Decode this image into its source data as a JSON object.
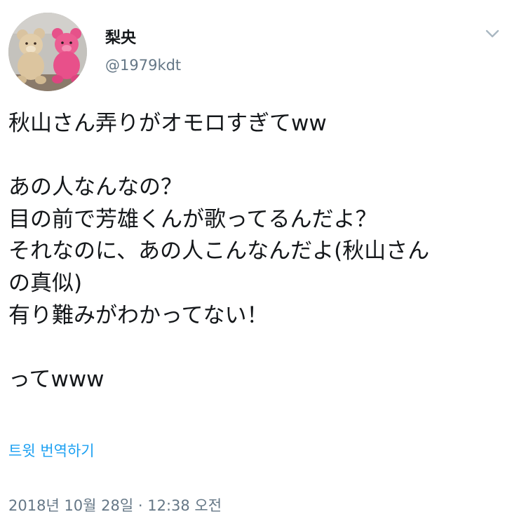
{
  "user": {
    "display_name": "梨央",
    "handle": "@1979kdt",
    "avatar_icon": "teddy-bears-avatar"
  },
  "tweet": {
    "lines": [
      "秋山さん弄りがオモロすぎてww",
      "",
      "あの人なんなの？",
      "目の前で芳雄くんが歌ってるんだよ？",
      "それなのに、あの人こんなんだよ(秋山さん",
      "の真似)",
      "有り難みがわかってない！",
      "",
      "ってwww"
    ],
    "translate_label": "트윗 번역하기",
    "timestamp": "2018년 10월 28일 · 12:38 오전"
  },
  "icons": {
    "menu": "chevron-down-icon"
  },
  "colors": {
    "text": "#14171a",
    "secondary": "#657786",
    "link": "#1da1f2"
  }
}
